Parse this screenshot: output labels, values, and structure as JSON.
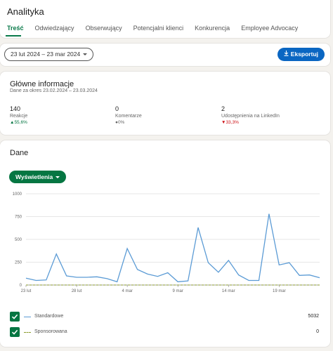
{
  "app": {
    "title": "Analityka"
  },
  "tabs": [
    {
      "label": "Treść",
      "active": true
    },
    {
      "label": "Odwiedzający",
      "active": false
    },
    {
      "label": "Obserwujący",
      "active": false
    },
    {
      "label": "Potencjalni klienci",
      "active": false
    },
    {
      "label": "Konkurencja",
      "active": false
    },
    {
      "label": "Employee Advocacy",
      "active": false
    }
  ],
  "filter": {
    "date_range": "23 lut 2024 – 23 mar 2024",
    "export_label": "Eksportuj"
  },
  "highlights": {
    "title": "Główne informacje",
    "subtitle": "Dane za okres 23.02.2024 – 23.03.2024",
    "metrics": [
      {
        "value": "140",
        "label": "Reakcje",
        "change": "55,6%",
        "trend": "up",
        "symbol": "▲"
      },
      {
        "value": "0",
        "label": "Komentarze",
        "change": "0%",
        "trend": "flat",
        "symbol": "●"
      },
      {
        "value": "2",
        "label": "Udostępnienia na LinkedIn",
        "change": "33,3%",
        "trend": "down",
        "symbol": "▼"
      }
    ]
  },
  "data_section": {
    "title": "Dane",
    "metric_selector": "Wyświetlenia"
  },
  "chart_data": {
    "type": "line",
    "x": [
      "23 lut",
      "24 lut",
      "25 lut",
      "26 lut",
      "27 lut",
      "28 lut",
      "29 lut",
      "1 mar",
      "2 mar",
      "3 mar",
      "4 mar",
      "5 mar",
      "6 mar",
      "7 mar",
      "8 mar",
      "9 mar",
      "10 mar",
      "11 mar",
      "12 mar",
      "13 mar",
      "14 mar",
      "15 mar",
      "16 mar",
      "17 mar",
      "18 mar",
      "19 mar",
      "20 mar",
      "21 mar",
      "22 mar",
      "23 mar"
    ],
    "x_tick_labels": [
      "23 lut",
      "28 lut",
      "4 mar",
      "9 mar",
      "14 mar",
      "19 mar"
    ],
    "y_ticks": [
      0,
      250,
      500,
      750,
      1000
    ],
    "ylim": [
      0,
      1000
    ],
    "grid": true,
    "series": [
      {
        "name": "Standardowe",
        "color": "#5b9bd5",
        "total": "5032",
        "values": [
          75,
          50,
          55,
          340,
          100,
          85,
          85,
          90,
          70,
          35,
          400,
          170,
          120,
          95,
          135,
          35,
          45,
          630,
          245,
          140,
          270,
          110,
          50,
          50,
          780,
          220,
          245,
          105,
          110,
          80
        ]
      },
      {
        "name": "Sponsorowana",
        "color": "#8a9a2b",
        "total": "0",
        "values": [
          0,
          0,
          0,
          0,
          0,
          0,
          0,
          0,
          0,
          0,
          0,
          0,
          0,
          0,
          0,
          0,
          0,
          0,
          0,
          0,
          0,
          0,
          0,
          0,
          0,
          0,
          0,
          0,
          0,
          0
        ]
      }
    ]
  }
}
